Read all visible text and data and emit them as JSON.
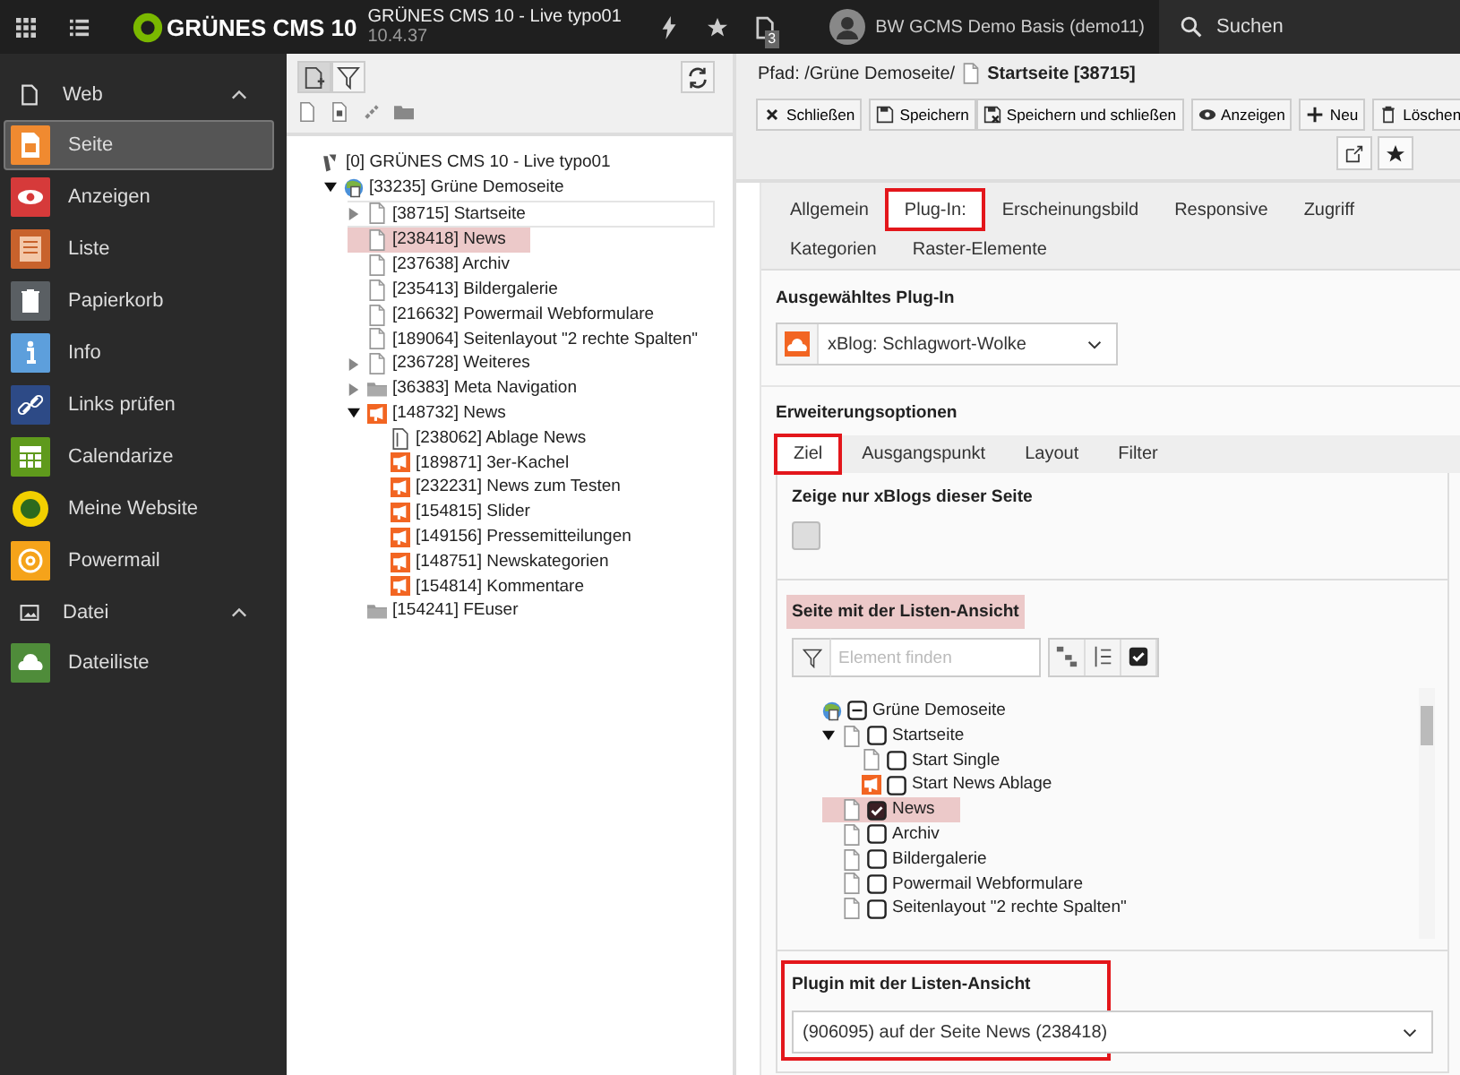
{
  "topbar": {
    "logo": "GRÜNES CMS 10",
    "site_name": "GRÜNES CMS 10 - Live typo01",
    "version": "10.4.37",
    "badge": "3",
    "user": "BW GCMS Demo Basis (demo11)",
    "search": {
      "placeholder": "Suchen"
    }
  },
  "modules": [
    {
      "label": "Web",
      "expanded": true,
      "items": [
        {
          "label": "Seite",
          "color": "#f08a30",
          "selected": true
        },
        {
          "label": "Anzeigen",
          "color": "#d63a3a",
          "selected": false
        },
        {
          "label": "Liste",
          "color": "#c8622c",
          "selected": false
        },
        {
          "label": "Papierkorb",
          "color": "#5a5f63",
          "selected": false
        },
        {
          "label": "Info",
          "color": "#5d9fdc",
          "selected": false
        },
        {
          "label": "Links prüfen",
          "color": "#2d4a86",
          "selected": false
        },
        {
          "label": "Calendarize",
          "color": "#5f9a1c",
          "selected": false
        },
        {
          "label": "Meine Website",
          "color": "#f2d000",
          "selected": false
        },
        {
          "label": "Powermail",
          "color": "#f5a31a",
          "selected": false
        }
      ]
    },
    {
      "label": "Datei",
      "expanded": true,
      "items": [
        {
          "label": "Dateiliste",
          "color": "#4f8c3a",
          "selected": false
        }
      ]
    }
  ],
  "page_tree": [
    {
      "label": "[0] GRÜNES CMS 10 - Live typo01",
      "kind": "root",
      "selected": false,
      "highlighted": false,
      "children": [
        {
          "label": "[33235] Grüne Demoseite",
          "kind": "site",
          "expanded": true,
          "selected": false,
          "highlighted": false,
          "children": [
            {
              "label": "[38715] Startseite",
              "kind": "page",
              "expanded": false,
              "selected": true,
              "highlighted": false
            },
            {
              "label": "[238418] News",
              "kind": "page",
              "selected": false,
              "highlighted": true
            },
            {
              "label": "[237638] Archiv",
              "kind": "page",
              "selected": false,
              "highlighted": false
            },
            {
              "label": "[235413] Bildergalerie",
              "kind": "page",
              "selected": false,
              "highlighted": false
            },
            {
              "label": "[216632] Powermail Webformulare",
              "kind": "page",
              "selected": false,
              "highlighted": false
            },
            {
              "label": "[189064] Seitenlayout \"2 rechte Spalten\"",
              "kind": "page",
              "selected": false,
              "highlighted": false
            },
            {
              "label": "[236728] Weiteres",
              "kind": "page",
              "expanded": false,
              "selected": false,
              "highlighted": false
            },
            {
              "label": "[36383] Meta Navigation",
              "kind": "folder",
              "expanded": false,
              "selected": false,
              "highlighted": false
            },
            {
              "label": "[148732] News",
              "kind": "news",
              "expanded": true,
              "selected": false,
              "highlighted": false,
              "children": [
                {
                  "label": "[238062] Ablage News",
                  "kind": "archive",
                  "selected": false,
                  "highlighted": false
                },
                {
                  "label": "[189871] 3er-Kachel",
                  "kind": "news",
                  "selected": false,
                  "highlighted": false
                },
                {
                  "label": "[232231] News zum Testen",
                  "kind": "news",
                  "selected": false,
                  "highlighted": false
                },
                {
                  "label": "[154815] Slider",
                  "kind": "news",
                  "selected": false,
                  "highlighted": false
                },
                {
                  "label": "[149156] Pressemitteilungen",
                  "kind": "news",
                  "selected": false,
                  "highlighted": false
                },
                {
                  "label": "[148751] Newskategorien",
                  "kind": "news",
                  "selected": false,
                  "highlighted": false
                },
                {
                  "label": "[154814] Kommentare",
                  "kind": "news",
                  "selected": false,
                  "highlighted": false
                }
              ]
            },
            {
              "label": "[154241] FEuser",
              "kind": "folder",
              "selected": false,
              "highlighted": false
            }
          ]
        }
      ]
    }
  ],
  "record": {
    "path": "Pfad: /Grüne Demoseite/",
    "title": "Startseite [38715]",
    "buttons": [
      {
        "label": "Schließen"
      },
      {
        "label": "Speichern"
      },
      {
        "label": "Speichern und schließen"
      },
      {
        "label": "Anzeigen"
      },
      {
        "label": "Neu"
      },
      {
        "label": "Löschen"
      }
    ]
  },
  "tabs": [
    {
      "label": "Allgemein",
      "selected": false,
      "annotated": false
    },
    {
      "label": "Plug-In:",
      "selected": true,
      "annotated": true
    },
    {
      "label": "Erscheinungsbild",
      "selected": false,
      "annotated": false
    },
    {
      "label": "Responsive",
      "selected": false,
      "annotated": false
    },
    {
      "label": "Zugriff",
      "selected": false,
      "annotated": false
    },
    {
      "label": "Kategorien",
      "selected": false,
      "annotated": false
    },
    {
      "label": "Raster-Elemente",
      "selected": false,
      "annotated": false
    }
  ],
  "plugin": {
    "label": "Ausgewähltes Plug-In",
    "value": "xBlog: Schlagwort-Wolke"
  },
  "options": {
    "label": "Erweiterungsoptionen",
    "tabs": [
      {
        "label": "Ziel",
        "selected": true,
        "annotated": true
      },
      {
        "label": "Ausgangspunkt",
        "selected": false,
        "annotated": false
      },
      {
        "label": "Layout",
        "selected": false,
        "annotated": false
      },
      {
        "label": "Filter",
        "selected": false,
        "annotated": false
      }
    ],
    "only_this_page": {
      "label": "Zeige nur xBlogs dieser Seite",
      "checked": false
    },
    "list_page": {
      "label": "Seite mit der Listen-Ansicht",
      "highlighted": true,
      "filter": {
        "placeholder": "Element finden"
      },
      "tree": [
        {
          "label": "Grüne Demoseite",
          "kind": "site",
          "checked": false,
          "indeterminate": true,
          "highlighted": false,
          "children": [
            {
              "label": "Startseite",
              "kind": "page",
              "expanded": true,
              "checked": false,
              "indeterminate": false,
              "highlighted": false,
              "children": [
                {
                  "label": "Start Single",
                  "kind": "page",
                  "checked": false,
                  "indeterminate": false,
                  "highlighted": false
                },
                {
                  "label": "Start News Ablage",
                  "kind": "news",
                  "checked": false,
                  "indeterminate": false,
                  "highlighted": false
                }
              ]
            },
            {
              "label": "News",
              "kind": "page",
              "checked": true,
              "indeterminate": false,
              "highlighted": true
            },
            {
              "label": "Archiv",
              "kind": "page",
              "checked": false,
              "indeterminate": false,
              "highlighted": false
            },
            {
              "label": "Bildergalerie",
              "kind": "page",
              "checked": false,
              "indeterminate": false,
              "highlighted": false
            },
            {
              "label": "Powermail Webformulare",
              "kind": "page",
              "checked": false,
              "indeterminate": false,
              "highlighted": false
            },
            {
              "label": "Seitenlayout \"2 rechte Spalten\"",
              "kind": "page",
              "checked": false,
              "indeterminate": false,
              "highlighted": false
            }
          ]
        }
      ]
    },
    "list_plugin": {
      "label": "Plugin mit der Listen-Ansicht",
      "annotated": true,
      "value": "(906095) auf der Seite News (238418)"
    }
  }
}
